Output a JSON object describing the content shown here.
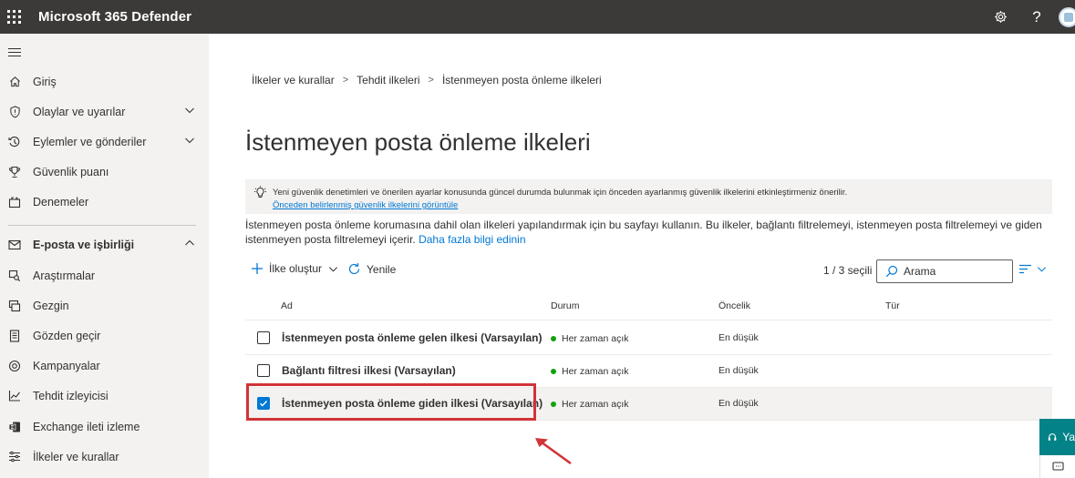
{
  "app": {
    "title": "Microsoft 365 Defender"
  },
  "nav": {
    "items": [
      {
        "label": "Giriş",
        "icon": "home-icon"
      },
      {
        "label": "Olaylar ve uyarılar",
        "icon": "shield-icon",
        "expandable": true
      },
      {
        "label": "Eylemler ve gönderiler",
        "icon": "history-icon",
        "expandable": true
      },
      {
        "label": "Güvenlik puanı",
        "icon": "trophy-icon"
      },
      {
        "label": "Denemeler",
        "icon": "lab-icon"
      },
      {
        "label": "E-posta ve işbirliği",
        "icon": "mail-icon",
        "expanded": true
      },
      {
        "label": "Araştırmalar",
        "icon": "investigation-icon"
      },
      {
        "label": "Gezgin",
        "icon": "explorer-icon"
      },
      {
        "label": "Gözden geçir",
        "icon": "review-icon"
      },
      {
        "label": "Kampanyalar",
        "icon": "target-icon"
      },
      {
        "label": "Tehdit izleyicisi",
        "icon": "chart-icon"
      },
      {
        "label": "Exchange ileti izleme",
        "icon": "exchange-icon"
      },
      {
        "label": "İlkeler ve kurallar",
        "icon": "policy-icon"
      }
    ]
  },
  "breadcrumb": [
    "İlkeler ve kurallar",
    "Tehdit ilkeleri",
    "İstenmeyen posta önleme ilkeleri"
  ],
  "page": {
    "title": "İstenmeyen posta önleme ilkeleri"
  },
  "banner": {
    "text": "Yeni güvenlik denetimleri ve önerilen ayarlar konusunda güncel durumda bulunmak için önceden ayarlanmış güvenlik ilkelerini etkinleştirmeniz önerilir.",
    "link": "Önceden belirlenmiş güvenlik ilkelerini görüntüle"
  },
  "description": {
    "text": "İstenmeyen posta önleme korumasına dahil olan ilkeleri yapılandırmak için bu sayfayı kullanın. Bu ilkeler, bağlantı filtrelemeyi, istenmeyen posta filtrelemeyi ve giden istenmeyen posta filtrelemeyi içerir.",
    "link": "Daha fazla bilgi edinin"
  },
  "toolbar": {
    "create_label": "İlke oluştur",
    "refresh_label": "Yenile",
    "count": "1 / 3 seçili",
    "search_placeholder": "Arama"
  },
  "table": {
    "headers": {
      "name": "Ad",
      "status": "Durum",
      "priority": "Öncelik",
      "type": "Tür"
    },
    "rows": [
      {
        "name": "İstenmeyen posta önleme gelen ilkesi (Varsayılan)",
        "status": "Her zaman açık",
        "priority": "En düşük",
        "checked": false
      },
      {
        "name": "Bağlantı filtresi ilkesi (Varsayılan)",
        "status": "Her zaman açık",
        "priority": "En düşük",
        "checked": false
      },
      {
        "name": "İstenmeyen posta önleme giden ilkesi (Varsayılan)",
        "status": "Her zaman açık",
        "priority": "En düşük",
        "checked": true
      }
    ]
  },
  "help": {
    "label": "Ya"
  },
  "colors": {
    "accent": "#0078d4",
    "topbar": "#3b3a39",
    "status_ok": "#13a10e",
    "highlight": "#d13438",
    "help": "#038387"
  }
}
